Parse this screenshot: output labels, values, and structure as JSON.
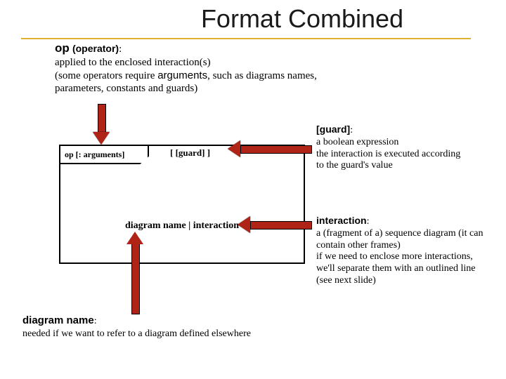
{
  "title": "Format Combined",
  "op": {
    "label": "op",
    "sub": "(operator)",
    "line1": "applied to the enclosed interaction(s)",
    "line2a": "(some operators require ",
    "line2b": "arguments",
    "line2c": ", such as diagrams names,",
    "line3": "parameters, constants and guards)"
  },
  "frame": {
    "pentagon": "op [: arguments]",
    "guard": "[  [guard]  ]",
    "center": "diagram name | interaction"
  },
  "guard_note": {
    "hdr": "[guard]",
    "l1": "a boolean expression",
    "l2": "the interaction is executed according",
    "l3": "to the guard's value"
  },
  "interaction_note": {
    "hdr": "interaction",
    "l1": "a (fragment of a) sequence diagram (it can",
    "l2": "contain other frames)",
    "l3": "if we need to enclose more interactions,",
    "l4": "we'll separate them with an outlined line",
    "l5": "(see next slide)"
  },
  "diagram_name_note": {
    "hdr": "diagram name",
    "l1": "needed if we want to refer to a diagram defined elsewhere"
  }
}
